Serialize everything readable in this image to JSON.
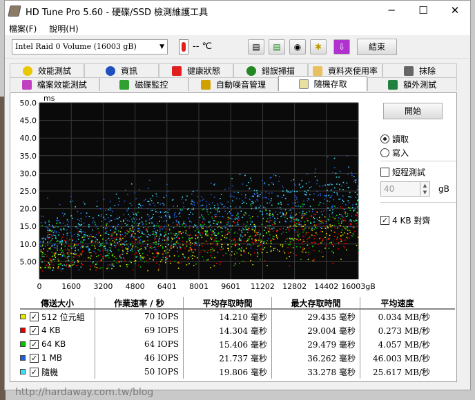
{
  "window": {
    "title": "HD Tune Pro 5.60 - 硬碟/SSD 檢測維護工具",
    "minimize": "─",
    "maximize": "☐",
    "close": "✕"
  },
  "menu": [
    "檔案(F)",
    "說明(H)"
  ],
  "toolbar": {
    "drive": "Intel  Raid 0 Volume (16003 gB)",
    "temperature": "-- ℃",
    "exit_label": "結束",
    "icons": [
      "copy-icon",
      "copy-green-icon",
      "camera-icon",
      "options-icon",
      "save-icon"
    ]
  },
  "tabs_row1": [
    {
      "label": "效能測試",
      "icon": "lightbulb-icon"
    },
    {
      "label": "資訊",
      "icon": "info-icon"
    },
    {
      "label": "健康狀態",
      "icon": "health-cross-icon"
    },
    {
      "label": "錯誤掃描",
      "icon": "magnifier-icon"
    },
    {
      "label": "資料夾使用率",
      "icon": "folder-icon"
    },
    {
      "label": "抹除",
      "icon": "trash-icon"
    }
  ],
  "tabs_row2": [
    {
      "label": "檔案效能測試",
      "icon": "file-benchmark-icon"
    },
    {
      "label": "磁碟監控",
      "icon": "disk-monitor-icon"
    },
    {
      "label": "自動噪音管理",
      "icon": "speaker-icon"
    },
    {
      "label": "隨機存取",
      "icon": "random-access-icon",
      "active": true
    },
    {
      "label": "額外測試",
      "icon": "extra-tests-icon"
    }
  ],
  "controls": {
    "start_label": "開始",
    "read_label": "讀取",
    "write_label": "寫入",
    "mode": "read",
    "short_test_label": "短程測試",
    "short_test_checked": false,
    "short_value": "40",
    "short_unit": "gB",
    "align_label": "4 KB 對齊",
    "align_checked": true
  },
  "results": {
    "headers": [
      "傳送大小",
      "作業速率 / 秒",
      "平均存取時間",
      "最大存取時間",
      "平均速度"
    ],
    "rows": [
      {
        "color": "#e8e800",
        "label": "512 位元組",
        "iops": "70 IOPS",
        "avg": "14.210 毫秒",
        "max": "29.435 毫秒",
        "speed": "0.034 MB/秒"
      },
      {
        "color": "#e00000",
        "label": "4 KB",
        "iops": "69 IOPS",
        "avg": "14.304 毫秒",
        "max": "29.004 毫秒",
        "speed": "0.273 MB/秒"
      },
      {
        "color": "#00c000",
        "label": "64 KB",
        "iops": "64 IOPS",
        "avg": "15.406 毫秒",
        "max": "29.479 毫秒",
        "speed": "4.057 MB/秒"
      },
      {
        "color": "#2060e0",
        "label": "1 MB",
        "iops": "46 IOPS",
        "avg": "21.737 毫秒",
        "max": "36.262 毫秒",
        "speed": "46.003 MB/秒"
      },
      {
        "color": "#40e0f0",
        "label": "隨機",
        "iops": "50 IOPS",
        "avg": "19.806 毫秒",
        "max": "33.278 毫秒",
        "speed": "25.617 MB/秒"
      }
    ]
  },
  "chart_data": {
    "type": "scatter",
    "ylabel": "ms",
    "ylim": [
      0,
      50
    ],
    "xlim": [
      0,
      16003
    ],
    "yticks": [
      "50.0",
      "45.0",
      "40.0",
      "35.0",
      "30.0",
      "25.0",
      "20.0",
      "15.0",
      "10.0",
      "5.00"
    ],
    "xticks": [
      "0",
      "1600",
      "3200",
      "4800",
      "6401",
      "8001",
      "9601",
      "11202",
      "12802",
      "14402",
      "16003gB"
    ],
    "series": [
      {
        "name": "512 位元組",
        "color": "#e8e800",
        "trend_ms": [
          [
            0,
            7
          ],
          [
            16003,
            14
          ]
        ]
      },
      {
        "name": "4 KB",
        "color": "#e00000",
        "trend_ms": [
          [
            0,
            7
          ],
          [
            16003,
            14
          ]
        ]
      },
      {
        "name": "64 KB",
        "color": "#00c000",
        "trend_ms": [
          [
            0,
            8
          ],
          [
            16003,
            16
          ]
        ]
      },
      {
        "name": "1 MB",
        "color": "#2060e0",
        "trend_ms": [
          [
            0,
            12
          ],
          [
            16003,
            25
          ]
        ]
      },
      {
        "name": "隨機",
        "color": "#40e0f0",
        "trend_ms": [
          [
            0,
            11
          ],
          [
            16003,
            24
          ]
        ]
      }
    ]
  },
  "watermark": "http://hardaway.com.tw/blog"
}
